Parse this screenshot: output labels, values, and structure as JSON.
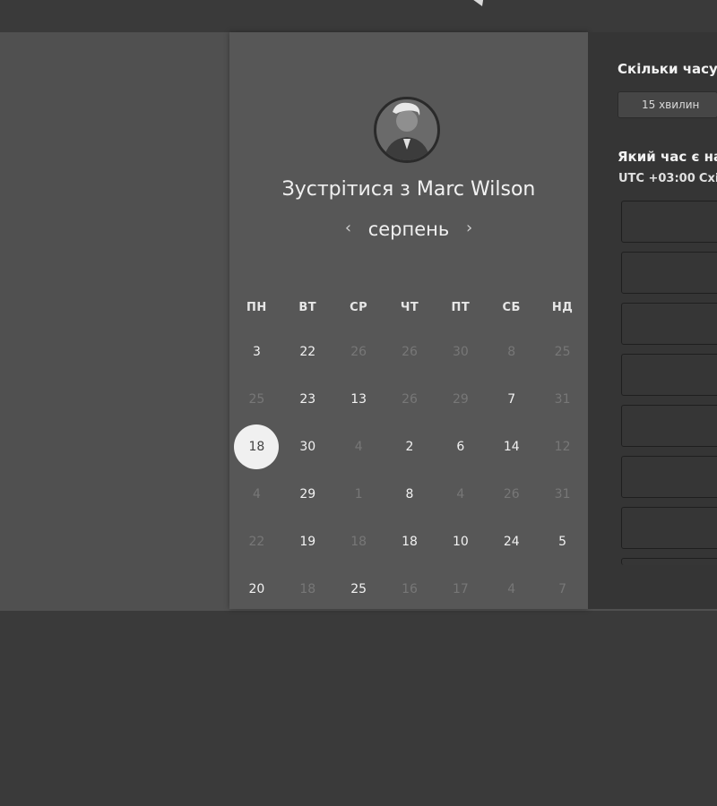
{
  "card": {
    "title_prefix": "Зустрітися з",
    "host_name": "Marc Wilson",
    "month": "серпень",
    "prev_arrow": "‹",
    "next_arrow": "›",
    "weekdays": [
      "ПН",
      "ВТ",
      "СР",
      "ЧТ",
      "ПТ",
      "СБ",
      "НД"
    ],
    "days": [
      [
        "3",
        "22",
        "26",
        "26",
        "30",
        "8",
        "25"
      ],
      [
        "25",
        "23",
        "13",
        "26",
        "29",
        "7",
        "31"
      ],
      [
        "18",
        "30",
        "4",
        "2",
        "6",
        "14",
        "12"
      ],
      [
        "4",
        "29",
        "1",
        "8",
        "4",
        "26",
        "31"
      ],
      [
        "22",
        "19",
        "18",
        "18",
        "10",
        "24",
        "5"
      ],
      [
        "20",
        "18",
        "25",
        "16",
        "17",
        "4",
        "7"
      ]
    ],
    "available": [
      [
        true,
        true,
        false,
        false,
        false,
        false,
        false
      ],
      [
        false,
        true,
        true,
        false,
        false,
        true,
        false
      ],
      [
        true,
        true,
        false,
        true,
        true,
        true,
        false
      ],
      [
        false,
        true,
        false,
        true,
        false,
        false,
        false
      ],
      [
        false,
        true,
        false,
        true,
        true,
        true,
        true
      ],
      [
        true,
        false,
        true,
        false,
        false,
        false,
        false
      ]
    ],
    "selected_day": "18"
  },
  "side": {
    "duration_question": "Скільки часу в",
    "duration_value": "15 хвилин",
    "time_question": "Який час є най",
    "timezone_prefix": "UTC +03:00",
    "timezone_name": "Схід"
  },
  "colors": {
    "selected_bg": "#f0f0f0",
    "card_bg": "#575757",
    "side_bg": "#353535"
  }
}
